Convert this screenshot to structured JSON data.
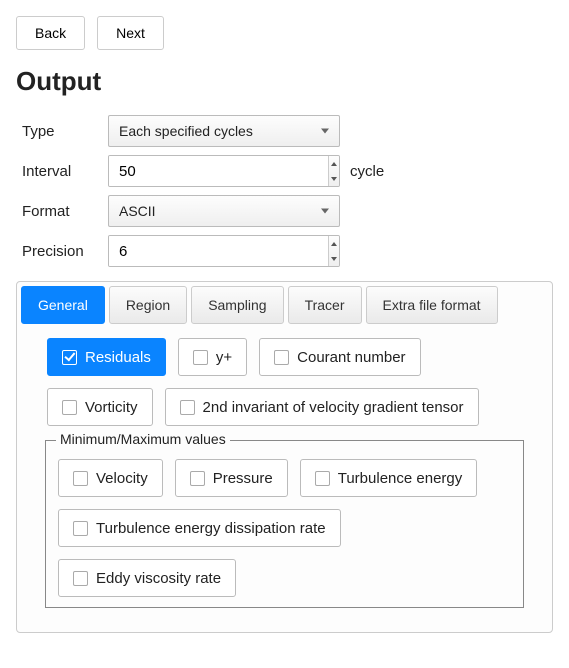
{
  "nav": {
    "back": "Back",
    "next": "Next"
  },
  "title": "Output",
  "form": {
    "type_label": "Type",
    "type_value": "Each specified cycles",
    "interval_label": "Interval",
    "interval_value": "50",
    "interval_unit": "cycle",
    "format_label": "Format",
    "format_value": "ASCII",
    "precision_label": "Precision",
    "precision_value": "6"
  },
  "tabs": {
    "general": "General",
    "region": "Region",
    "sampling": "Sampling",
    "tracer": "Tracer",
    "extra": "Extra file format",
    "active": "general"
  },
  "checks": {
    "residuals": "Residuals",
    "yplus": "y+",
    "courant": "Courant number",
    "vorticity": "Vorticity",
    "second_invariant": "2nd invariant of velocity gradient tensor"
  },
  "minmax": {
    "legend": "Minimum/Maximum values",
    "velocity": "Velocity",
    "pressure": "Pressure",
    "turb_energy": "Turbulence energy",
    "turb_diss": "Turbulence energy dissipation rate",
    "eddy_visc": "Eddy viscosity rate"
  }
}
